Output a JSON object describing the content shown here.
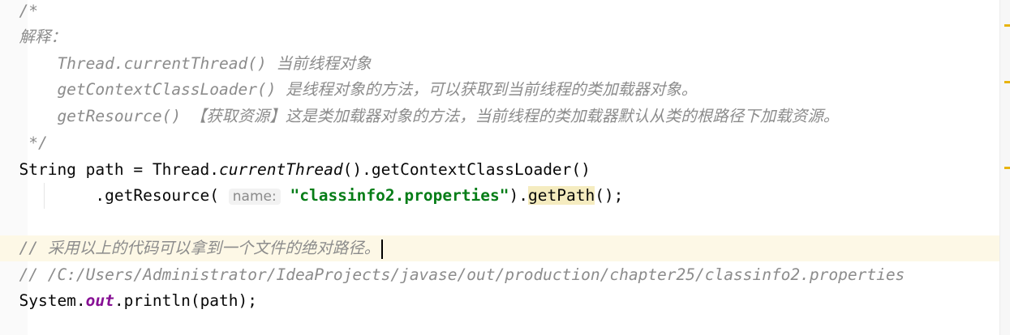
{
  "editor": {
    "lines": [
      {
        "t": "comment",
        "text": "  /*"
      },
      {
        "t": "comment",
        "text": "  解释："
      },
      {
        "t": "comment",
        "text": "      Thread.currentThread() 当前线程对象"
      },
      {
        "t": "comment",
        "text": "      getContextClassLoader() 是线程对象的方法，可以获取到当前线程的类加载器对象。"
      },
      {
        "t": "comment",
        "text": "      getResource() 【获取资源】这是类加载器对象的方法，当前线程的类加载器默认从类的根路径下加载资源。"
      },
      {
        "t": "comment",
        "text": "   */"
      },
      {
        "t": "code1",
        "a": "  String path = Thread.",
        "b": "currentThread",
        "c": "().getContextClassLoader()"
      },
      {
        "t": "code2",
        "a": "          .getResource(",
        "hint": "name:",
        "str": "\"classinfo2.properties\"",
        "d": ").",
        "e": "getPath",
        "f": "();"
      },
      {
        "t": "blank",
        "text": ""
      },
      {
        "t": "current",
        "text": "  // 采用以上的代码可以拿到一个文件的绝对路径。"
      },
      {
        "t": "comment",
        "text": "  // /C:/Users/Administrator/IdeaProjects/javase/out/production/chapter25/classinfo2.properties"
      },
      {
        "t": "code3",
        "a": "  System.",
        "b": "out",
        "c": ".println(path);"
      }
    ]
  }
}
